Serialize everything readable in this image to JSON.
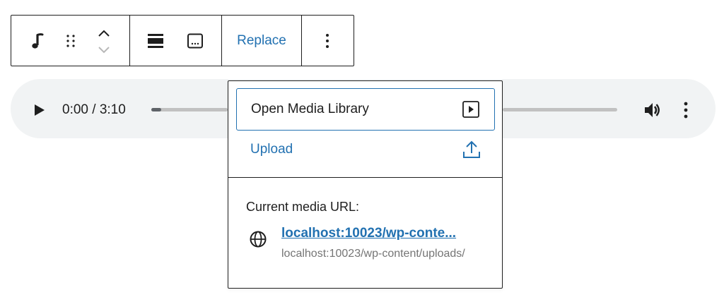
{
  "toolbar": {
    "block_type_icon": "audio-note-icon",
    "drag_handle_icon": "drag-handle-icon",
    "move_up_icon": "chevron-up-icon",
    "move_down_icon": "chevron-down-icon",
    "align_icon": "align-wide-icon",
    "caption_icon": "caption-icon",
    "replace_label": "Replace",
    "options_icon": "more-vertical-icon"
  },
  "player": {
    "play_icon": "play-icon",
    "time_display": "0:00 / 3:10",
    "progress": 0.0,
    "volume_icon": "volume-icon",
    "menu_icon": "more-vertical-icon"
  },
  "popover": {
    "open_media_library_label": "Open Media Library",
    "open_media_library_icon": "media-play-icon",
    "upload_label": "Upload",
    "upload_icon": "upload-icon",
    "current_url_label": "Current media URL:",
    "globe_icon": "globe-icon",
    "url_short": "localhost:10023/wp-conte...",
    "url_full": "localhost:10023/wp-content/uploads/"
  },
  "colors": {
    "accent": "#2271b1",
    "text": "#1e1e1e",
    "muted": "#757575",
    "player_bg": "#f1f3f4"
  }
}
